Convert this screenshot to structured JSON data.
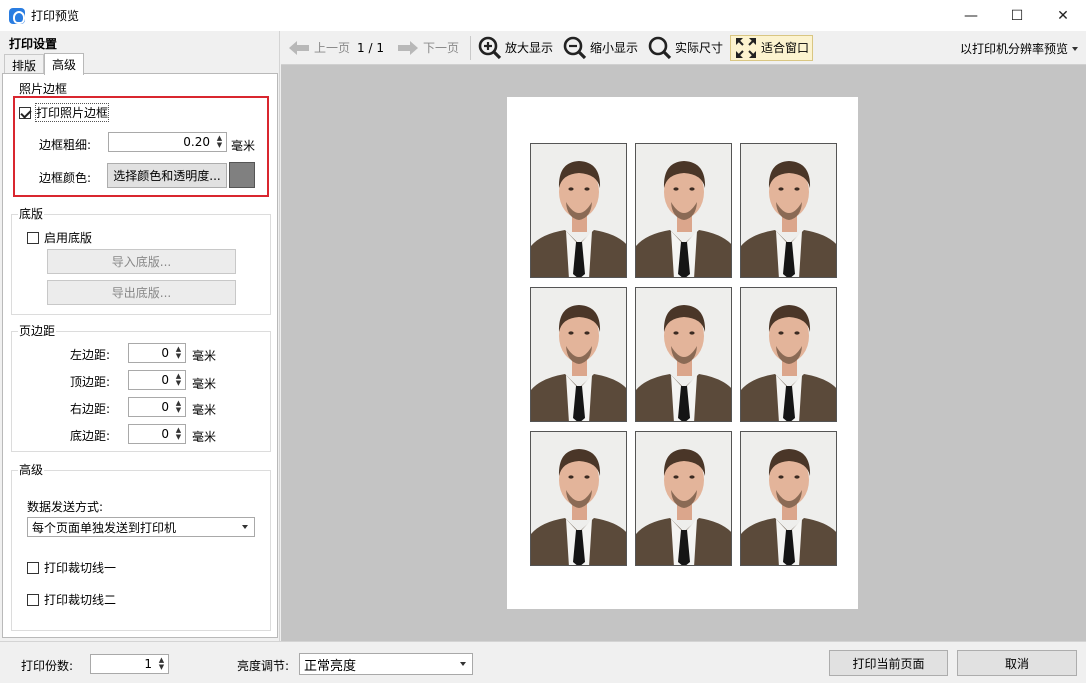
{
  "window": {
    "title": "打印预览",
    "minimize": "—",
    "maximize": "☐",
    "close": "✕"
  },
  "panel": {
    "title": "打印设置",
    "tabs": [
      {
        "label": "排版",
        "active": false
      },
      {
        "label": "高级",
        "active": true
      }
    ]
  },
  "photo_border": {
    "group_label": "照片边框",
    "print_border_label": "打印照片边框",
    "print_border_checked": true,
    "thickness_label": "边框粗细:",
    "thickness_value": "0.20",
    "thickness_unit": "毫米",
    "color_label": "边框颜色:",
    "color_button": "选择颜色和透明度...",
    "color_value": "#808080"
  },
  "backplate": {
    "group_label": "底版",
    "enable_label": "启用底版",
    "enable_checked": false,
    "import_button": "导入底版...",
    "export_button": "导出底版..."
  },
  "margins": {
    "group_label": "页边距",
    "left_label": "左边距:",
    "left_value": "0",
    "top_label": "顶边距:",
    "top_value": "0",
    "right_label": "右边距:",
    "right_value": "0",
    "bottom_label": "底边距:",
    "bottom_value": "0",
    "unit": "毫米"
  },
  "advanced": {
    "group_label": "高级",
    "send_mode_label": "数据发送方式:",
    "send_mode_value": "每个页面单独发送到打印机",
    "cut_line_1_label": "打印裁切线一",
    "cut_line_1_checked": false,
    "cut_line_2_label": "打印裁切线二",
    "cut_line_2_checked": false
  },
  "toolbar": {
    "prev_page": "上一页",
    "page_indicator": "1 / 1",
    "next_page": "下一页",
    "zoom_in": "放大显示",
    "zoom_out": "缩小显示",
    "actual_size": "实际尺寸",
    "fit_window": "适合窗口",
    "preview_mode": "以打印机分辨率预览"
  },
  "preview": {
    "photo_count": 9,
    "columns": 3,
    "rows": 3
  },
  "bottom": {
    "copies_label": "打印份数:",
    "copies_value": "1",
    "brightness_label": "亮度调节:",
    "brightness_value": "正常亮度",
    "print_button": "打印当前页面",
    "cancel_button": "取消"
  },
  "colors": {
    "highlight": "#d9262f",
    "preview_bg": "#c4c4c4",
    "active_tool_bg": "#fcf3cf"
  }
}
